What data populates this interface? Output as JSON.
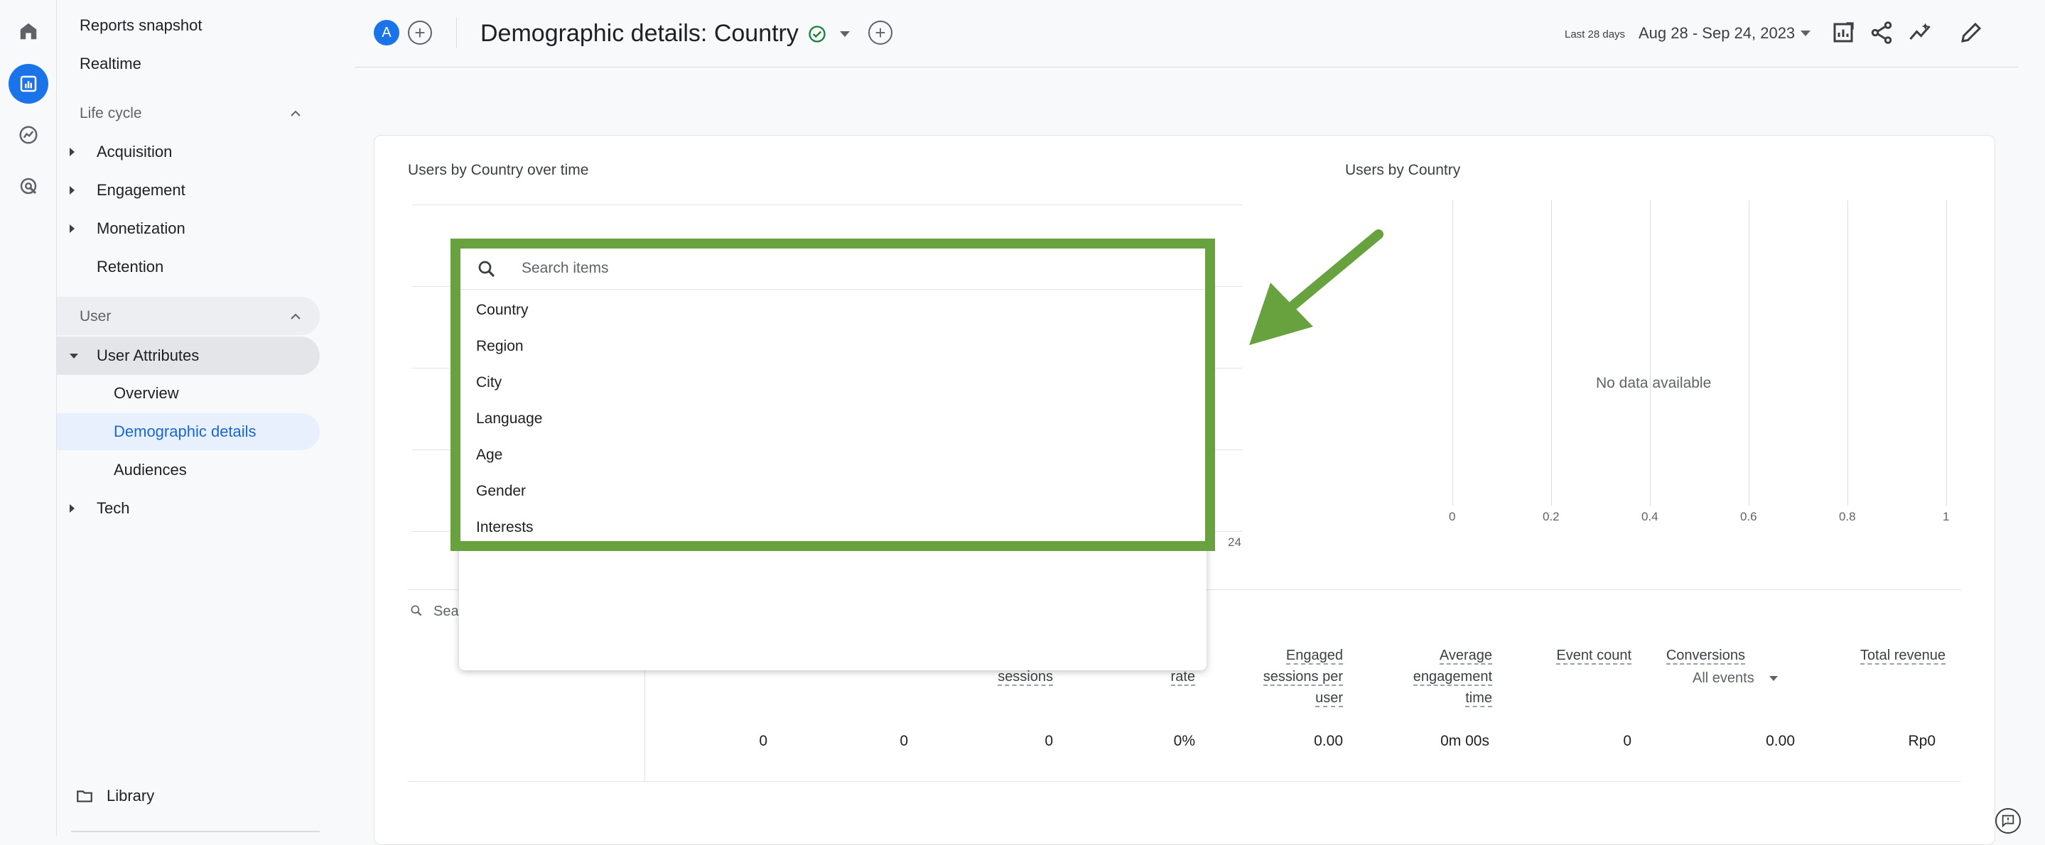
{
  "sidebar": {
    "items": [
      {
        "label": "Reports snapshot"
      },
      {
        "label": "Realtime"
      },
      {
        "label": "Life cycle"
      },
      {
        "label": "Acquisition"
      },
      {
        "label": "Engagement"
      },
      {
        "label": "Monetization"
      },
      {
        "label": "Retention"
      },
      {
        "label": "User"
      },
      {
        "label": "User Attributes"
      },
      {
        "label": "Overview"
      },
      {
        "label": "Demographic details"
      },
      {
        "label": "Audiences"
      },
      {
        "label": "Tech"
      }
    ],
    "library": "Library"
  },
  "header": {
    "avatar_letter": "A",
    "title": "Demographic details: Country",
    "date_label": "Last 28 days",
    "date_range": "Aug 28 - Sep 24, 2023",
    "plus": "+"
  },
  "card": {
    "left_title": "Users by Country over time",
    "right_title": "Users by Country",
    "no_data": "No data available",
    "right_ticks": [
      "0",
      "0.2",
      "0.4",
      "0.6",
      "0.8",
      "1"
    ],
    "left_tick": "24",
    "search_partial": "Sear"
  },
  "dropdown": {
    "search_placeholder": "Search items",
    "items": [
      "Country",
      "Region",
      "City",
      "Language",
      "Age",
      "Gender",
      "Interests"
    ]
  },
  "table": {
    "headers": [
      {
        "lines": [
          "sessions"
        ]
      },
      {
        "lines": [
          "rate"
        ]
      },
      {
        "lines": [
          "Engaged",
          "sessions per",
          "user"
        ]
      },
      {
        "lines": [
          "Average",
          "engagement",
          "time"
        ]
      },
      {
        "lines": [
          "Event count"
        ]
      },
      {
        "lines": [
          "Conversions"
        ]
      },
      {
        "lines": [
          "Total revenue"
        ]
      }
    ],
    "conversions_filter": "All events",
    "values": [
      "0",
      "0",
      "0",
      "0%",
      "0.00",
      "0m 00s",
      "0",
      "0.00",
      "Rp0"
    ]
  },
  "colors": {
    "accent": "#1a73e8",
    "highlight": "#67a23e"
  }
}
